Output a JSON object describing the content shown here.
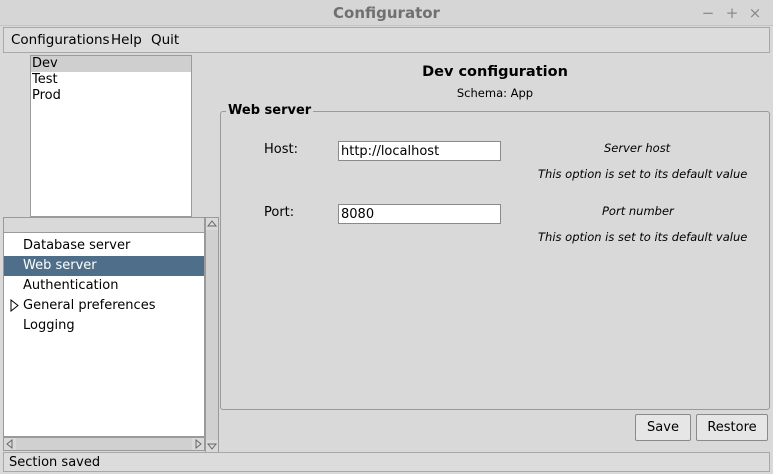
{
  "window": {
    "title": "Configurator",
    "minimize_glyph": "−",
    "maximize_glyph": "+",
    "close_glyph": "×"
  },
  "menu": {
    "configurations": "Configurations",
    "help": "Help",
    "quit": "Quit"
  },
  "configs": {
    "items": [
      "Dev",
      "Test",
      "Prod"
    ],
    "selected": "Dev"
  },
  "sections": {
    "items": [
      "Database server",
      "Web server",
      "Authentication",
      "General preferences",
      "Logging"
    ],
    "selected": "Web server",
    "expandable": "General preferences"
  },
  "main": {
    "title": "Dev configuration",
    "schema": "Schema: App",
    "section_title": "Web server",
    "fields": [
      {
        "label": "Host:",
        "value": "http://localhost",
        "description": "Server host",
        "note": "This option is set to its default value"
      },
      {
        "label": "Port:",
        "value": "8080",
        "description": "Port number",
        "note": "This option is set to its default value"
      }
    ]
  },
  "buttons": {
    "save": "Save",
    "restore": "Restore"
  },
  "status": {
    "text": "Section saved"
  },
  "colors": {
    "selection": "#4f6e8a",
    "list_selection": "#cfcfcf"
  }
}
